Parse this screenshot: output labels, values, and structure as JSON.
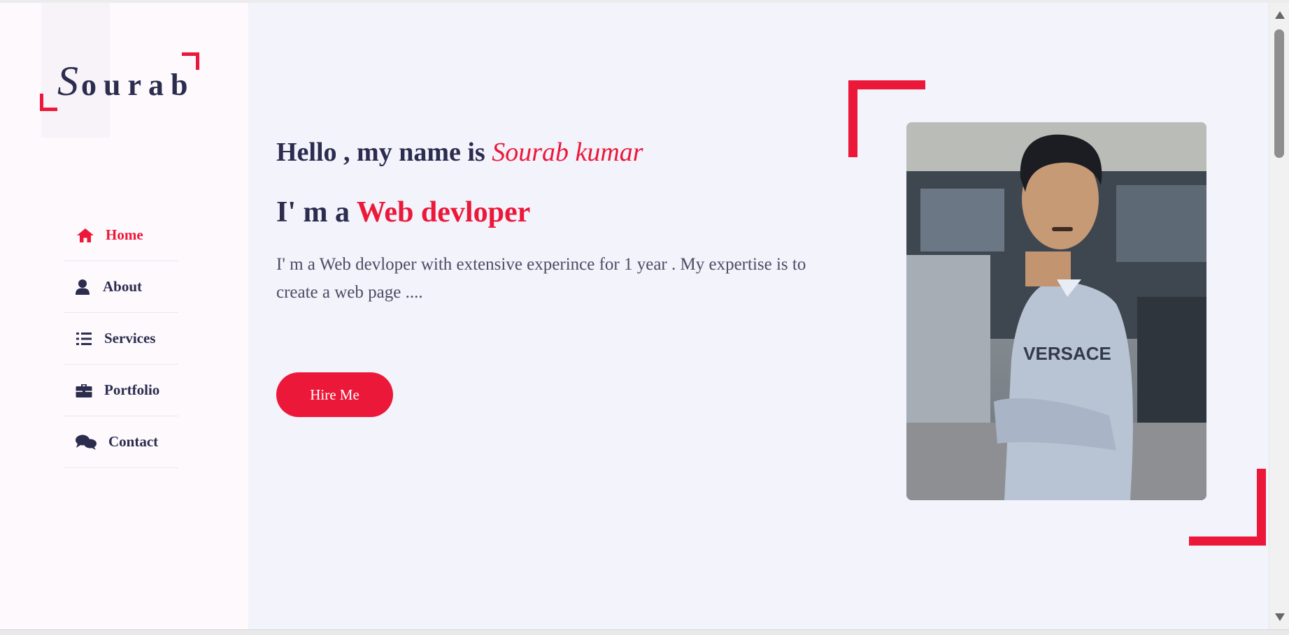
{
  "brand": {
    "logo_initial": "S",
    "logo_rest": "ourab"
  },
  "nav": {
    "items": [
      {
        "label": "Home",
        "icon": "home-icon",
        "active": true
      },
      {
        "label": "About",
        "icon": "user-icon",
        "active": false
      },
      {
        "label": "Services",
        "icon": "list-icon",
        "active": false
      },
      {
        "label": "Portfolio",
        "icon": "briefcase-icon",
        "active": false
      },
      {
        "label": "Contact",
        "icon": "comments-icon",
        "active": false
      }
    ]
  },
  "hero": {
    "greeting": "Hello , my name is ",
    "name": "Sourab kumar",
    "role_prefix": "I' m a ",
    "role": "Web devloper",
    "description": "I' m a Web devloper with extensive experince for 1 year . My expertise is to create a web page ....",
    "cta_label": "Hire Me",
    "photo_alt": "Profile photo"
  },
  "colors": {
    "accent": "#ec1839",
    "text": "#2b2c4e",
    "background": "#f2f3fb",
    "sidebar": "#fdf9fd"
  }
}
